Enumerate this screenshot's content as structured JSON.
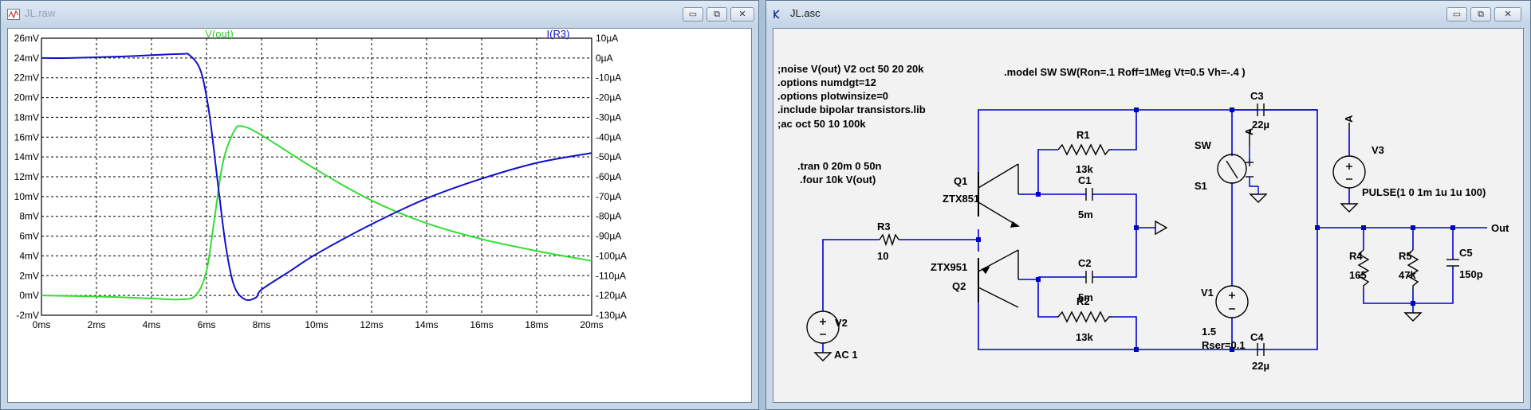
{
  "plot_window": {
    "title": "JL.raw",
    "controls": {
      "minimize": "▭",
      "restore": "⧉",
      "close": "✕"
    },
    "trace_labels": {
      "vout": "V(out)",
      "ir3": "I(R3)"
    },
    "colors": {
      "vout": "#33dd33",
      "ir3": "#1010cc"
    }
  },
  "schematic_window": {
    "title": "JL.asc",
    "controls": {
      "minimize": "▭",
      "restore": "⧉",
      "close": "✕"
    },
    "directives": {
      "noise": ";noise V(out) V2 oct 50 20 20k",
      "numdgt": ".options numdgt=12",
      "plotwinsize": ".options plotwinsize=0",
      "include": ".include bipolar transistors.lib",
      "ac": ";ac oct 50 10 100k",
      "tran": ".tran 0 20m 0 50n",
      "four": ".four 10k V(out)",
      "model": ".model SW SW(Ron=.1 Roff=1Meg Vt=0.5 Vh=-.4 )"
    },
    "components": {
      "R1": {
        "name": "R1",
        "value": "13k"
      },
      "R2": {
        "name": "R2",
        "value": "13k"
      },
      "R3": {
        "name": "R3",
        "value": "10"
      },
      "R4": {
        "name": "R4",
        "value": "165"
      },
      "R5": {
        "name": "R5",
        "value": "47k"
      },
      "C1": {
        "name": "C1",
        "value": "5m"
      },
      "C2": {
        "name": "C2",
        "value": "5m"
      },
      "C3": {
        "name": "C3",
        "value": "22µ"
      },
      "C4": {
        "name": "C4",
        "value": "22µ"
      },
      "C5": {
        "name": "C5",
        "value": "150p"
      },
      "Q1": {
        "name": "Q1",
        "value": "ZTX851"
      },
      "Q2": {
        "name": "Q2",
        "value": "ZTX951"
      },
      "V1": {
        "name": "V1",
        "value": "1.5",
        "extra": "Rser=0.1"
      },
      "V2": {
        "name": "V2",
        "value": "AC 1"
      },
      "V3": {
        "name": "V3",
        "value": "PULSE(1 0 1m 1u 1u 100)"
      },
      "SW": {
        "name": "SW",
        "inst": "S1"
      }
    },
    "net_labels": {
      "A1": "A",
      "A2": "A",
      "out": "Out"
    }
  },
  "chart_data": {
    "type": "line",
    "x_unit": "ms",
    "xlim": [
      0,
      20
    ],
    "x_ticks": [
      "0ms",
      "2ms",
      "4ms",
      "6ms",
      "8ms",
      "10ms",
      "12ms",
      "14ms",
      "16ms",
      "18ms",
      "20ms"
    ],
    "left_axis": {
      "unit": "mV",
      "ylim": [
        -2,
        26
      ],
      "ticks": [
        "-2mV",
        "0mV",
        "2mV",
        "4mV",
        "6mV",
        "8mV",
        "10mV",
        "12mV",
        "14mV",
        "16mV",
        "18mV",
        "20mV",
        "22mV",
        "24mV",
        "26mV"
      ]
    },
    "right_axis": {
      "unit": "µA",
      "ylim": [
        -130,
        10
      ],
      "ticks": [
        "-130µA",
        "-120µA",
        "-110µA",
        "-100µA",
        "-90µA",
        "-80µA",
        "-70µA",
        "-60µA",
        "-50µA",
        "-40µA",
        "-30µA",
        "-20µA",
        "-10µA",
        "0µA",
        "10µA"
      ]
    },
    "grid": true,
    "series": [
      {
        "name": "V(out)",
        "axis": "left",
        "color": "#33dd33",
        "x": [
          0,
          2,
          4,
          5,
          5.6,
          6.0,
          6.3,
          6.6,
          7.0,
          7.3,
          8,
          10,
          12,
          14,
          16,
          18,
          20
        ],
        "y": [
          0,
          -0.1,
          -0.3,
          -0.4,
          0,
          2.5,
          8,
          13.5,
          16.6,
          17.1,
          16.2,
          12.7,
          9.6,
          7.3,
          5.7,
          4.5,
          3.5
        ]
      },
      {
        "name": "I(R3)",
        "axis": "right",
        "color": "#1010cc",
        "x": [
          0,
          1,
          3,
          5,
          5.4,
          5.8,
          6.1,
          6.4,
          6.7,
          7.0,
          7.4,
          7.8,
          8,
          9,
          10,
          12,
          14,
          16,
          18,
          20
        ],
        "y": [
          0,
          0,
          0.8,
          2,
          1.2,
          -7,
          -28,
          -62,
          -95,
          -115,
          -122,
          -121,
          -117,
          -108,
          -99,
          -84,
          -71,
          -61,
          -53,
          -48
        ]
      }
    ]
  }
}
